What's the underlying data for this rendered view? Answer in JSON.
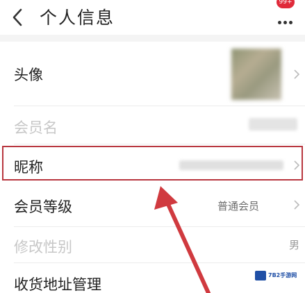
{
  "header": {
    "title": "个人信息",
    "badge": "99+",
    "back_icon": "chevron-left-icon",
    "more_icon": "more-dots-icon"
  },
  "rows": {
    "avatar": {
      "label": "头像"
    },
    "member_name": {
      "label": "会员名"
    },
    "nickname": {
      "label": "昵称"
    },
    "member_level": {
      "label": "会员等级",
      "value": "普通会员"
    },
    "gender": {
      "label": "修改性别",
      "value": "男"
    },
    "address": {
      "label": "收货地址管理"
    }
  },
  "watermark": {
    "text": "7B2手游网"
  },
  "colors": {
    "highlight": "#b8363f",
    "badge": "#e02a3a",
    "arrow": "#d03a3f"
  }
}
